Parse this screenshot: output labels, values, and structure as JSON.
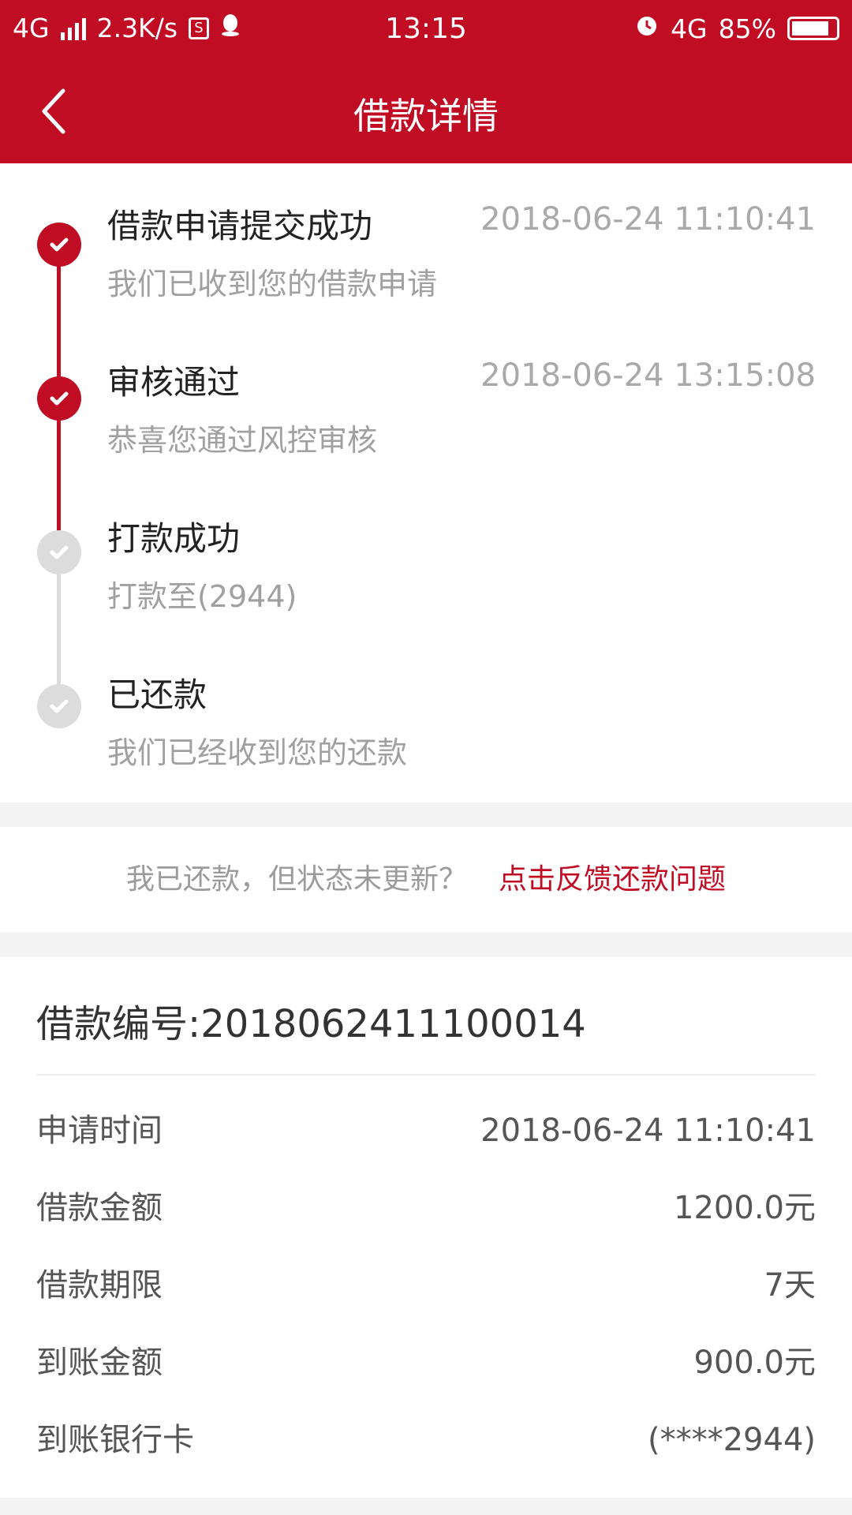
{
  "status_bar": {
    "network": "4G",
    "speed": "2.3K/s",
    "time": "13:15",
    "network2": "4G",
    "battery": "85%",
    "battery_level": 0.85
  },
  "header": {
    "title": "借款详情"
  },
  "timeline": {
    "steps": [
      {
        "title": "借款申请提交成功",
        "time": "2018-06-24 11:10:41",
        "desc": "我们已收到您的借款申请",
        "done": true
      },
      {
        "title": "审核通过",
        "time": "2018-06-24 13:15:08",
        "desc": "恭喜您通过风控审核",
        "done": true
      },
      {
        "title": "打款成功",
        "time": "",
        "desc": "打款至(2944)",
        "done": false
      },
      {
        "title": "已还款",
        "time": "",
        "desc": "我们已经收到您的还款",
        "done": false
      }
    ]
  },
  "feedback": {
    "question": "我已还款，但状态未更新？",
    "link": "点击反馈还款问题"
  },
  "details": {
    "loan_no_label": "借款编号:",
    "loan_no": "2018062411100014",
    "rows": [
      {
        "label": "申请时间",
        "value": "2018-06-24 11:10:41"
      },
      {
        "label": "借款金额",
        "value": "1200.0元"
      },
      {
        "label": "借款期限",
        "value": "7天"
      },
      {
        "label": "到账金额",
        "value": "900.0元"
      },
      {
        "label": "到账银行卡",
        "value": "(****2944)"
      }
    ]
  },
  "colors": {
    "brand": "#c10d23",
    "pending": "#dcdcdc"
  }
}
